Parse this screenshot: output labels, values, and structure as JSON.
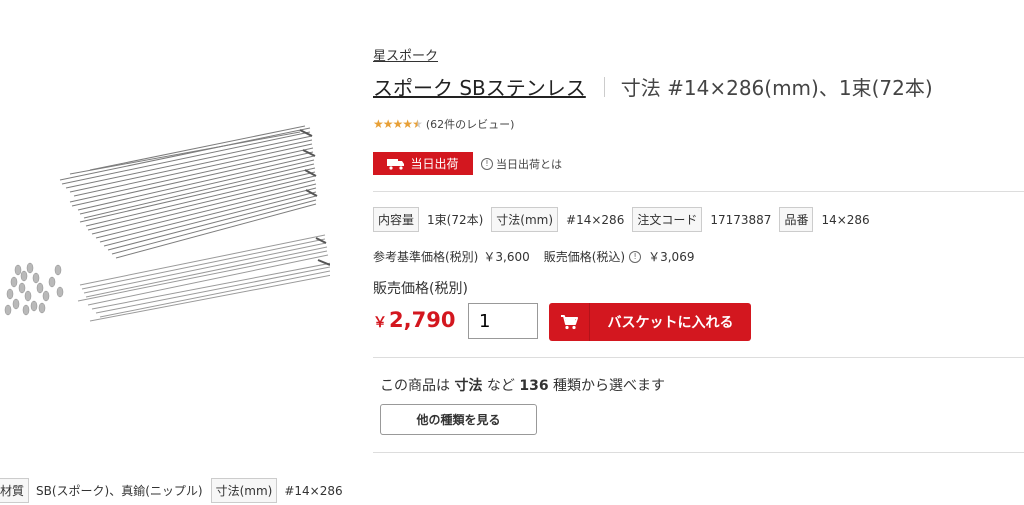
{
  "product": {
    "brand": "星スポーク",
    "title_main": "スポーク SBステンレス",
    "title_sub": "寸法 #14×286(mm)、1束(72本)",
    "rating_value": 4.5,
    "review_count_text": "(62件のレビュー)",
    "image_icon": "spokes-and-nipples-photo"
  },
  "shipping": {
    "badge_label": "当日出荷",
    "badge_icon": "truck-icon",
    "info_link": "当日出荷とは",
    "info_icon": "info-circle-icon"
  },
  "specs": [
    {
      "label": "内容量",
      "value": "1束(72本)"
    },
    {
      "label": "寸法(mm)",
      "value": "#14×286"
    },
    {
      "label": "注文コード",
      "value": "17173887"
    },
    {
      "label": "品番",
      "value": "14×286"
    }
  ],
  "pricing": {
    "ref_label": "参考基準価格(税別)",
    "ref_value": "￥3,600",
    "sale_incl_label": "販売価格(税込)",
    "sale_incl_value": "￥3,069",
    "sale_label": "販売価格(税別)",
    "currency_symbol": "￥",
    "sale_value": "2,790"
  },
  "cart": {
    "quantity": "1",
    "button_label": "バスケットに入れる",
    "button_icon": "cart-icon"
  },
  "variants": {
    "prefix": "この商品は",
    "attribute": "寸法",
    "middle": "など",
    "count": "136",
    "suffix": "種類から選べます",
    "button_label": "他の種類を見る"
  },
  "material_specs": [
    {
      "label": "材質",
      "value": "SB(スポーク)、真鍮(ニップル)"
    },
    {
      "label": "寸法(mm)",
      "value": "#14×286"
    }
  ],
  "colors": {
    "accent_red": "#d3171f",
    "star": "#e8a037"
  }
}
